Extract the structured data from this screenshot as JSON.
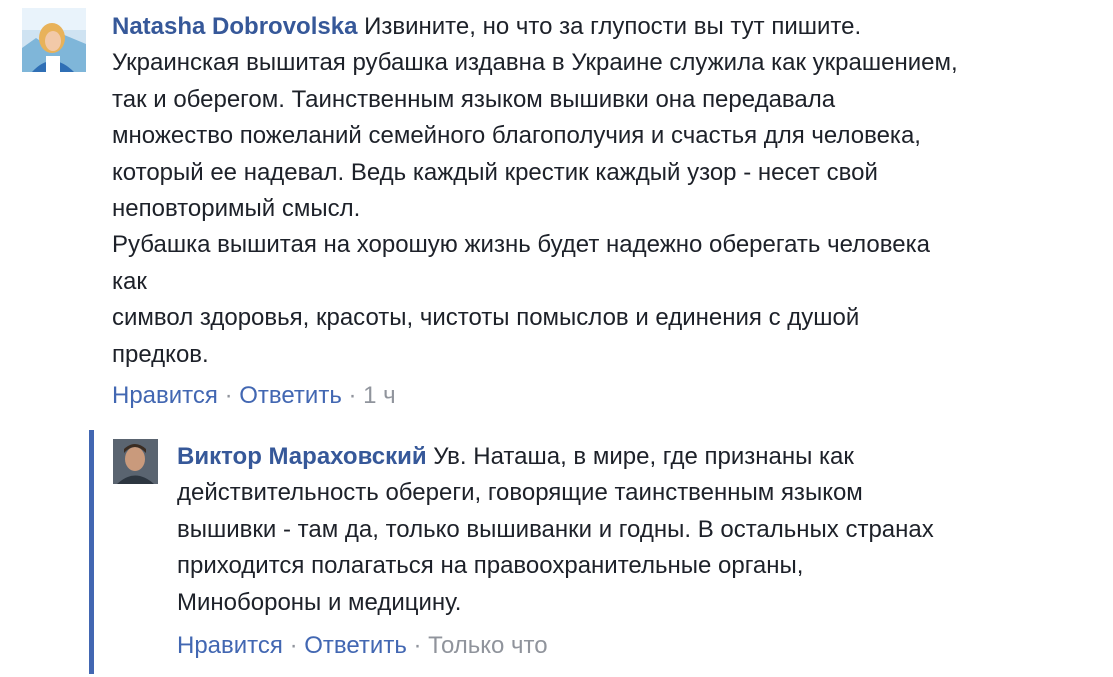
{
  "comments": [
    {
      "author": "Natasha Dobrovolska",
      "text": " Извините, но что за глупости вы тут пишите.\nУкраинская вышитая рубашка издавна в Украине служила как украшением,\nтак и оберегом. Таинственным языком вышивки она передавала\nмножество пожеланий семейного благополучия и счастья для человека,\nкоторый ее надевал. Ведь каждый крестик каждый узор - несет свой\nнеповторимый смысл.\nРубашка вышитая на хорошую жизнь будет надежно оберегать человека\nкак\nсимвол здоровья, красоты, чистоты помыслов и единения с душой\nпредков.",
      "like_label": "Нравится",
      "reply_label": "Ответить",
      "separator": " · ",
      "time": "1 ч",
      "avatar_icon": "user-avatar-natasha"
    },
    {
      "author": "Виктор Мараховский",
      "text": " Ув. Наташа, в мире, где признаны как\nдействительность обереги, говорящие таинственным языком\nвышивки - там да, только вышиванки и годны. В остальных странах\nприходится полагаться на правоохранительные органы,\nМинобороны и медицину.",
      "like_label": "Нравится",
      "reply_label": "Ответить",
      "separator": " · ",
      "time": "Только что",
      "avatar_icon": "user-avatar-viktor"
    }
  ],
  "colors": {
    "author": "#365899",
    "link": "#4267b2",
    "meta": "#90949c",
    "text": "#1d2129",
    "reply_bar": "#4267b2"
  }
}
